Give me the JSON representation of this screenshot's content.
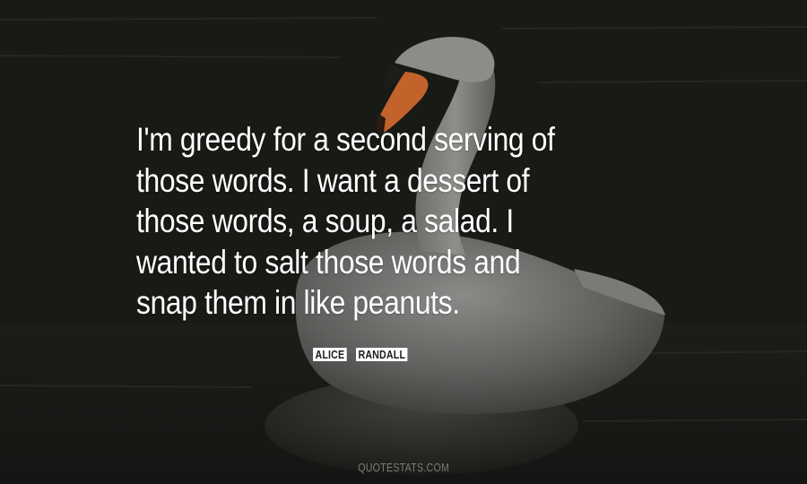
{
  "quote": {
    "lines": [
      "I'm greedy for a second serving of",
      "those words. I want a dessert of",
      "those words, a soup, a salad. I",
      "wanted to salt those words and",
      "snap them in like peanuts."
    ]
  },
  "author": {
    "first": "ALICE",
    "last": "RANDALL"
  },
  "footer": {
    "watermark": "QUOTESTATS.COM"
  }
}
